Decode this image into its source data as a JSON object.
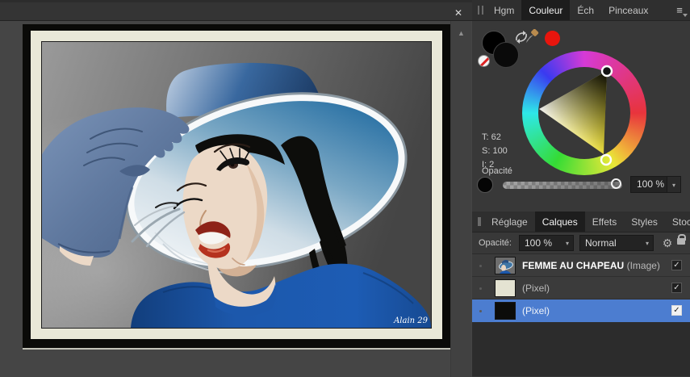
{
  "icons": {
    "close": "✕",
    "panel_menu": "≡",
    "scroll_up": "▲",
    "dropdown": "▾",
    "check": "✓",
    "gear": "⚙"
  },
  "document": {
    "signature": "Alain 29"
  },
  "color_panel": {
    "tabs": [
      {
        "label": "Hgm",
        "active": false
      },
      {
        "label": "Couleur",
        "active": true
      },
      {
        "label": "Éch",
        "active": false
      },
      {
        "label": "Pinceaux",
        "active": false
      }
    ],
    "readouts": [
      "T: 62",
      "S: 100",
      "I: 2"
    ],
    "opacity_label": "Opacité",
    "opacity_value": "100 %",
    "swatches": {
      "primary_color": "#000000",
      "secondary_color": "#0a0a0a",
      "recent_color": "#e8150d"
    }
  },
  "layers_panel": {
    "tabs": [
      {
        "label": "Réglage",
        "active": false
      },
      {
        "label": "Calques",
        "active": true
      },
      {
        "label": "Effets",
        "active": false
      },
      {
        "label": "Styles",
        "active": false
      },
      {
        "label": "Stock",
        "active": false
      }
    ],
    "opacity_label": "Opacité:",
    "opacity_value": "100 %",
    "blend_mode": "Normal",
    "selection_color": "#4c7dd0",
    "layers": [
      {
        "name": "FEMME AU CHAPEAU",
        "type": "(Image)",
        "selected": false,
        "visible": true
      },
      {
        "name": "",
        "type": "(Pixel)",
        "selected": false,
        "visible": true
      },
      {
        "name": "",
        "type": "(Pixel)",
        "selected": true,
        "visible": true
      }
    ]
  }
}
